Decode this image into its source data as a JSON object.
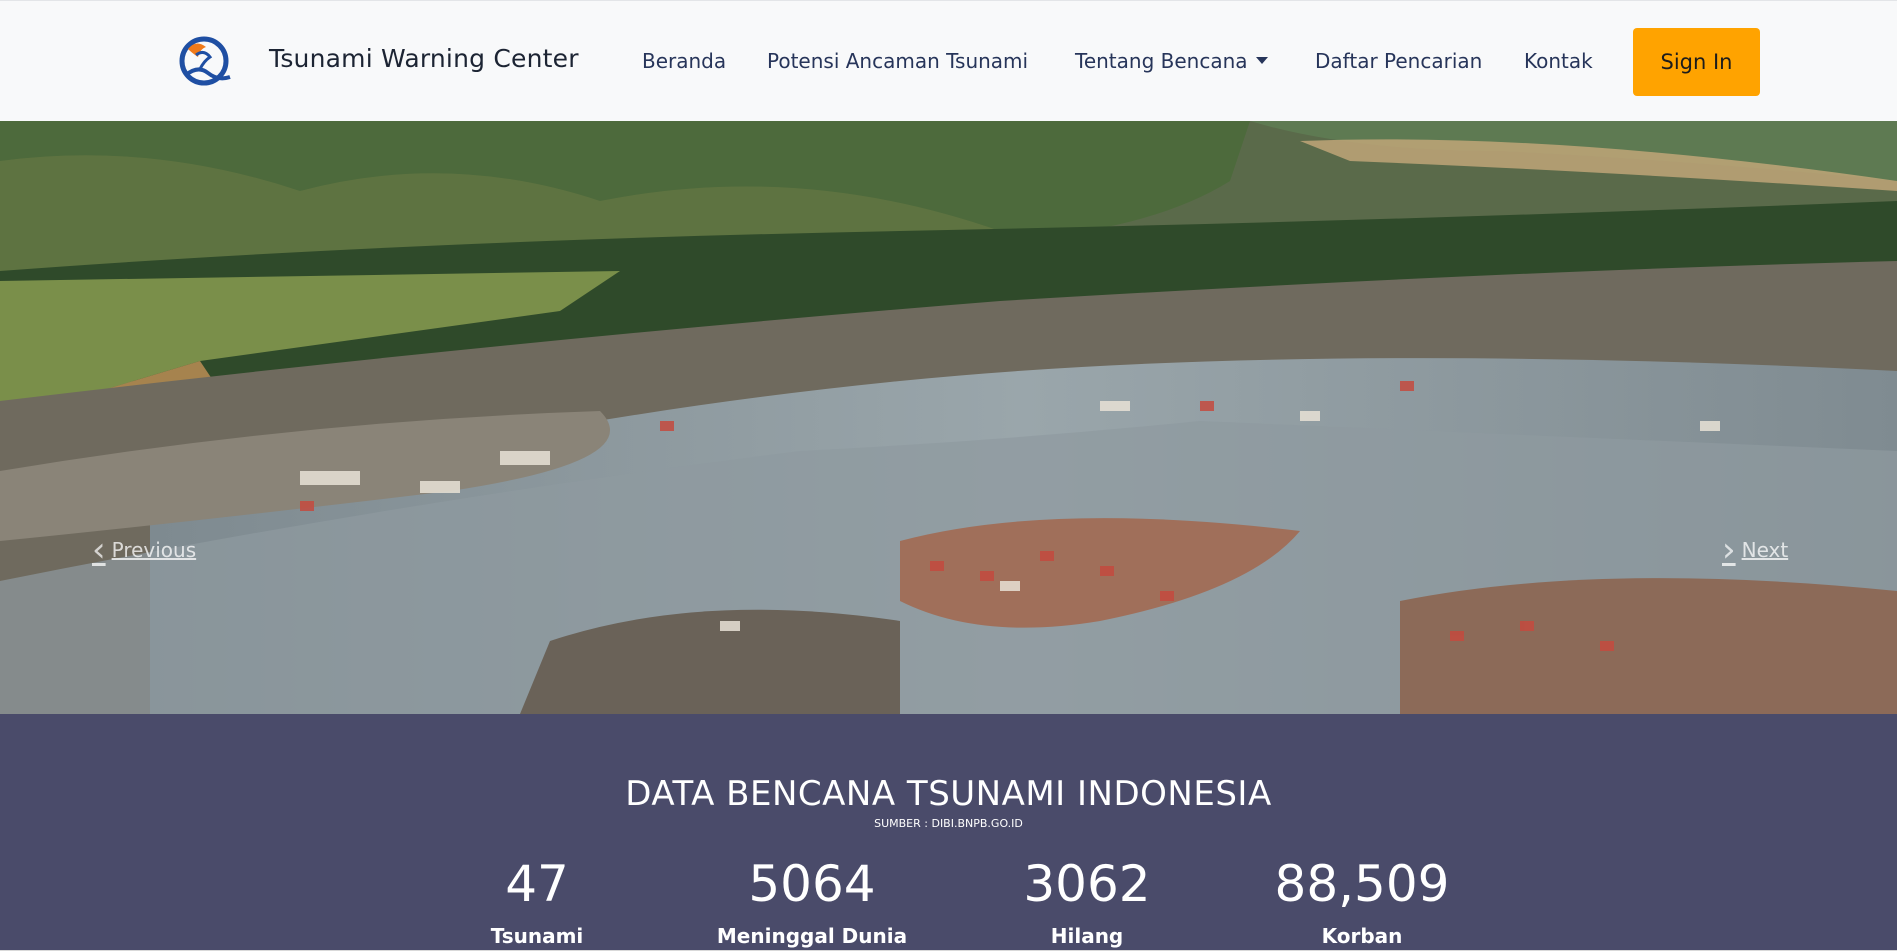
{
  "header": {
    "brand": "Tsunami Warning Center",
    "nav": [
      {
        "label": "Beranda"
      },
      {
        "label": "Potensi Ancaman Tsunami"
      },
      {
        "label": "Tentang Bencana"
      },
      {
        "label": "Daftar Pencarian"
      },
      {
        "label": "Kontak"
      }
    ],
    "signin_label": "Sign In"
  },
  "hero": {
    "previous_label": "Previous",
    "next_label": "Next"
  },
  "stats": {
    "title": "DATA BENCANA TSUNAMI INDONESIA",
    "source": "SUMBER : DIBI.BNPB.GO.ID",
    "items": [
      {
        "value": "47",
        "label": "Tsunami"
      },
      {
        "value": "5064",
        "label": "Meninggal Dunia"
      },
      {
        "value": "3062",
        "label": "Hilang"
      },
      {
        "value": "88,509",
        "label": "Korban"
      }
    ]
  },
  "colors": {
    "accent": "#ffa300",
    "nav_text": "#27355a",
    "stats_bg": "#4a4b6a"
  }
}
